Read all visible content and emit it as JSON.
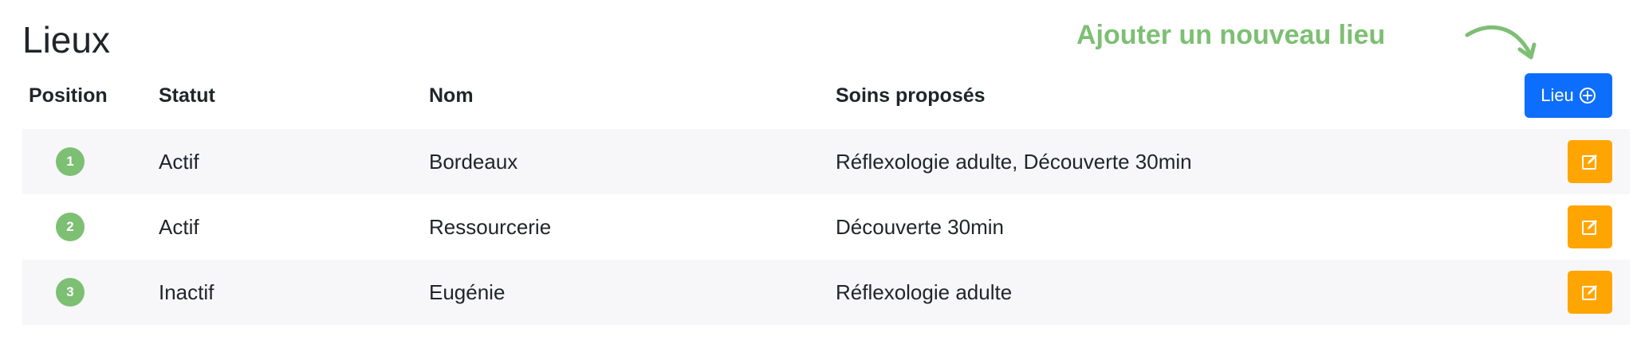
{
  "page": {
    "title": "Lieux",
    "annotation": "Ajouter un nouveau lieu",
    "add_button_label": "Lieu"
  },
  "table": {
    "headers": {
      "position": "Position",
      "status": "Statut",
      "name": "Nom",
      "services": "Soins proposés"
    },
    "rows": [
      {
        "position": "1",
        "status": "Actif",
        "name": "Bordeaux",
        "services": "Réflexologie adulte, Découverte 30min"
      },
      {
        "position": "2",
        "status": "Actif",
        "name": "Ressourcerie",
        "services": "Découverte 30min"
      },
      {
        "position": "3",
        "status": "Inactif",
        "name": "Eugénie",
        "services": "Réflexologie adulte"
      }
    ]
  },
  "icons": {
    "add": "plus-circle-icon",
    "edit": "edit-icon",
    "arrow": "curved-arrow-icon"
  },
  "colors": {
    "primary": "#0d6efd",
    "warning": "#ffa502",
    "success": "#7dbf73",
    "stripe": "#f7f7fa",
    "text": "#212529"
  }
}
